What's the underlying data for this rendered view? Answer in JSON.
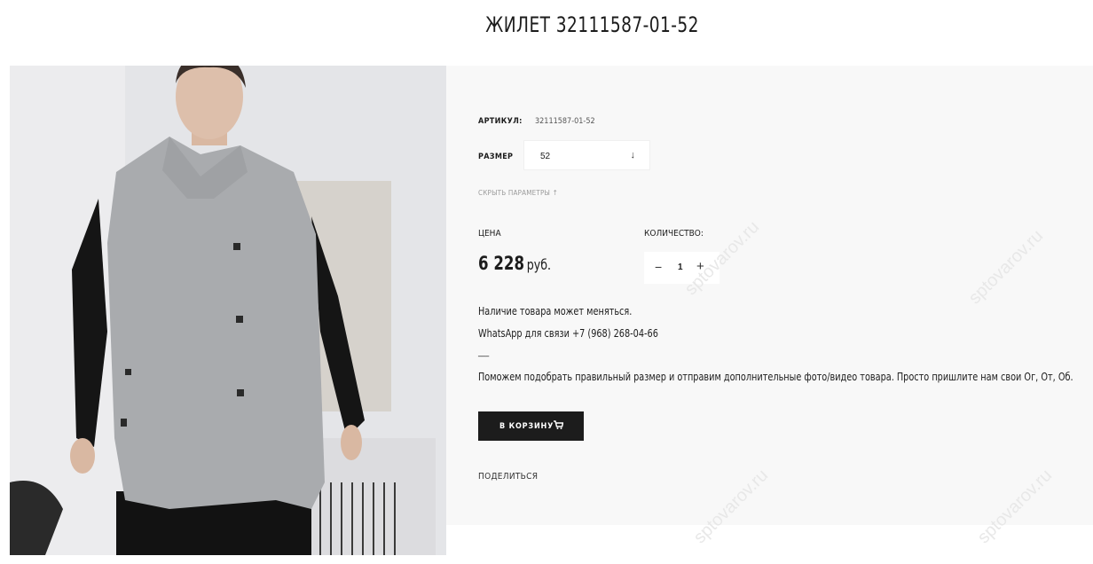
{
  "product": {
    "title": "ЖИЛЕТ 32111587-01-52",
    "article_label": "АРТИКУЛ:",
    "article_value": "32111587-01-52",
    "size_label": "РАЗМЕР",
    "size_value": "52",
    "size_arrow": "↓",
    "hide_params": "СКРЫТЬ ПАРАМЕТРЫ  ↑",
    "price_label": "ЦЕНА",
    "price_value": "6 228",
    "price_currency": "руб.",
    "quantity_label": "КОЛИЧЕСТВО:",
    "quantity_value": "1",
    "minus": "−",
    "plus": "+",
    "availability": "Наличие товара может меняться.",
    "whatsapp": " WhatsApp для связи +7 (968) 268-04-66",
    "separator": "___",
    "help_text": "Поможем подобрать правильный размер и отправим дополнительные фото/видео товара. Просто пришлите нам свои Ог, От, Об.",
    "cart_button": "В КОРЗИНУ",
    "share": "ПОДЕЛИТЬСЯ"
  },
  "watermark": "sptovarov.ru",
  "colors": {
    "panel_bg": "#f8f8f8",
    "button_bg": "#1c1c1c",
    "text": "#1c1c1c"
  }
}
